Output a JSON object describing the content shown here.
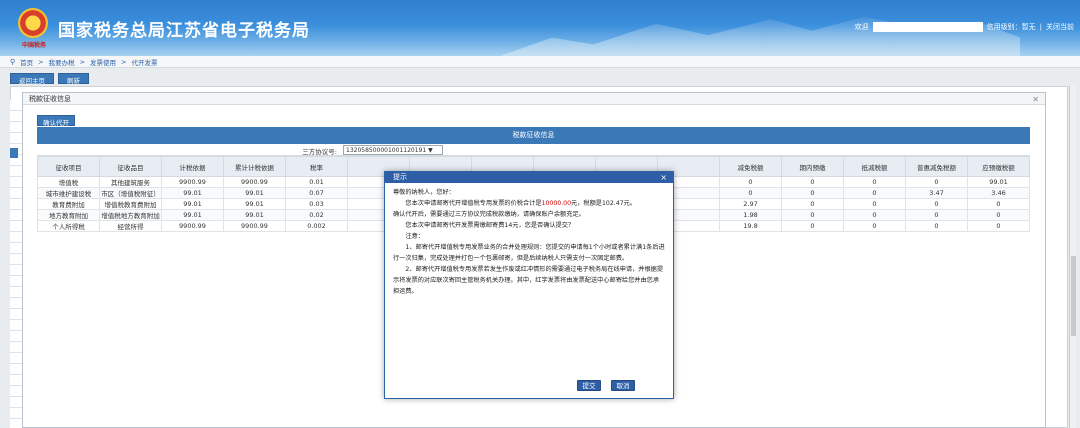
{
  "header": {
    "title": "国家税务总局江苏省电子税务局",
    "emblem_text": "中国税务",
    "welcome": "欢迎",
    "credit": "信用级别：暂无",
    "separator": "|",
    "close_page": "关闭当前"
  },
  "breadcrumb": [
    "首页",
    ">",
    "我要办税",
    ">",
    "发票使用",
    ">",
    "代开发票"
  ],
  "top_tabs": [
    "返回主页",
    "刷新"
  ],
  "modal": {
    "title": "税款征收信息",
    "close": "✕",
    "confirm_label": "确认代开",
    "table_title": "税款征收信息",
    "agreement_label": "三方协议号:",
    "agreement_value": "132058500001001120191 ▼",
    "columns": [
      "征收项目",
      "征收品目",
      "计税依据",
      "累计计税依据",
      "税率",
      "",
      "",
      "",
      "",
      "",
      "",
      "减免税额",
      "期内预缴",
      "抵减税额",
      "普惠减免税额",
      "应预缴税额"
    ],
    "rows": [
      [
        "增值税",
        "其他建筑服务",
        "9900.99",
        "9900.99",
        "0.01",
        "",
        "",
        "",
        "",
        "",
        "",
        "0",
        "0",
        "0",
        "0",
        "99.01"
      ],
      [
        "城市维护建设税",
        "市区（增值税附征）",
        "99.01",
        "99.01",
        "0.07",
        "",
        "",
        "",
        "",
        "",
        "",
        "0",
        "0",
        "0",
        "3.47",
        "3.46"
      ],
      [
        "教育费附加",
        "增值税教育费附加",
        "99.01",
        "99.01",
        "0.03",
        "",
        "",
        "",
        "",
        "",
        "",
        "2.97",
        "0",
        "0",
        "0",
        "0"
      ],
      [
        "地方教育附加",
        "增值税地方教育附加",
        "99.01",
        "99.01",
        "0.02",
        "",
        "",
        "",
        "",
        "",
        "",
        "1.98",
        "0",
        "0",
        "0",
        "0"
      ],
      [
        "个人所得税",
        "经营所得",
        "9900.99",
        "9900.99",
        "0.002",
        "",
        "",
        "",
        "",
        "",
        "",
        "19.8",
        "0",
        "0",
        "0",
        "0"
      ]
    ]
  },
  "dialog": {
    "title": "提示",
    "close": "×",
    "greeting": "尊敬的纳税人，您好：",
    "p1_a": "您本次申请邮寄代开增值税专用发票的价税合计是",
    "p1_amount": "10000.00",
    "p1_b": "元，税额是102.47元。",
    "p1_c": "确认代开后，需要通过三方协议完成税款缴纳，请确保账户余额充足。",
    "p2": "您本次申请邮寄代开发票需缴邮寄费14元，您是否确认提交？",
    "note": "注意：",
    "n1": "1、邮寄代开增值税专用发票业务的合并处理规则：您提交的申请每1个小时或者累计满1条后进行一次归集，完成处理并打包一个包裹邮寄，但是后续纳税人只需支付一次固定邮费。",
    "n2": "2、邮寄代开增值税专用发票若发生作废或红冲情形的需要通过电子税务局在线申请，并根据提示将发票的对应联次寄回主管税务机关办理。其中，红字发票将由发票配送中心邮寄给您并由您承担运费。",
    "submit": "提交",
    "cancel": "取消"
  },
  "colors": {
    "accent": "#2e5fa6",
    "header": "#3b8fdc",
    "highlight": "#d20000"
  }
}
